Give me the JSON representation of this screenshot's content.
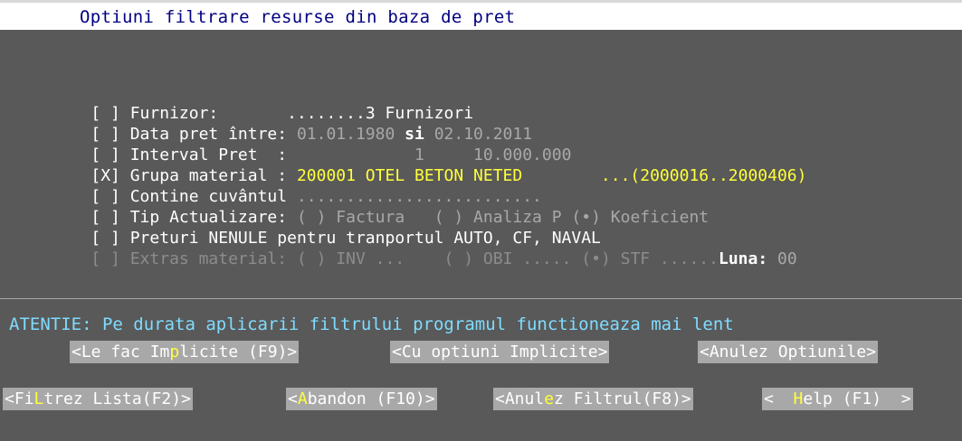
{
  "window": {
    "title": "Optiuni filtrare resurse din baza de pret"
  },
  "filters": [
    {
      "checkbox": "[ ]",
      "label": "Furnizor:",
      "value": "........3 Furnizori"
    },
    {
      "checkbox": "[ ]",
      "label": "Data pret între:",
      "from": "01.01.1980",
      "join": "si",
      "to": "02.10.2011"
    },
    {
      "checkbox": "[ ]",
      "label": "Interval Pret  :",
      "min": "1",
      "max": "10.000.000"
    },
    {
      "checkbox": "[X]",
      "label": "Grupa material :",
      "value": "200001 OTEL BETON NETED",
      "range": "...(2000016..2000406)"
    },
    {
      "checkbox": "[ ]",
      "label": "Contine cuvântul",
      "value": "........................."
    },
    {
      "checkbox": "[ ]",
      "label": "Tip Actualizare:",
      "options": [
        "( ) Factura",
        "( ) Analiza P",
        "(•) Koeficient"
      ]
    },
    {
      "checkbox": "[ ]",
      "label": "Preturi NENULE pentru tranportul AUTO, CF, NAVAL"
    },
    {
      "checkbox": "[ ]",
      "label": "Extras material:",
      "options": [
        "( ) INV ...",
        "( ) OBI .....",
        "(•) STF ......"
      ],
      "luna_label": "Luna:",
      "luna_value": "00"
    }
  ],
  "warning": "ATENTIE: Pe durata aplicarii filtrului programul functioneaza mai lent",
  "buttons_row1": [
    {
      "pre": "<Le fac Im",
      "hot": "p",
      "post": "licite (F9)>"
    },
    {
      "pre": "<Cu optiuni Implicite>",
      "hot": "",
      "post": ""
    },
    {
      "pre": "<Anulez Optiunile>",
      "hot": "",
      "post": ""
    }
  ],
  "buttons_row2": [
    {
      "pre": "<Fi",
      "hot": "L",
      "post": "trez Lista(F2)>"
    },
    {
      "pre": "<",
      "hot": "A",
      "post": "bandon (F10)>"
    },
    {
      "pre": "<Anul",
      "hot": "e",
      "post": "z Filtrul(F8)>"
    },
    {
      "pre": "<  ",
      "hot": "H",
      "post": "elp (F1)  >"
    }
  ],
  "colors": {
    "background": "#595959",
    "text": "#ffffff",
    "highlight": "#ffff3c",
    "button": "#a8a8a8",
    "warning": "#7fdcff",
    "title": "#000080"
  }
}
